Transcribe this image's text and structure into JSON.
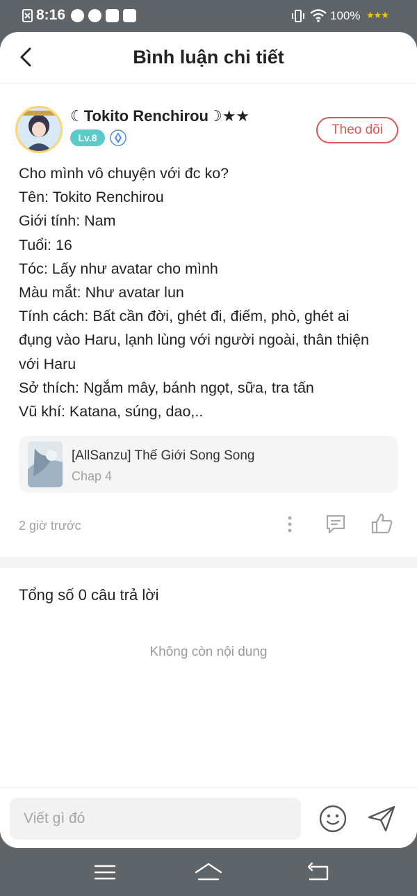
{
  "status_bar": {
    "time": "8:16",
    "battery": "100%",
    "icons": [
      "sim-icon",
      "app-icon",
      "app-icon",
      "mic-icon",
      "video-icon",
      "vibrate-icon",
      "wifi-icon",
      "stars-icon"
    ]
  },
  "header": {
    "title": "Bình luận chi tiết",
    "back_icon": "chevron-left-icon"
  },
  "comment": {
    "author": "☾Tokito Renchirou☽★★",
    "level": "Lv.8",
    "follow_label": "Theo dõi",
    "lines": [
      "Cho mình vô chuyện với đc ko?",
      "Tên: Tokito Renchirou",
      "Giới tính: Nam",
      "Tuổi: 16",
      "Tóc: Lấy như avatar cho mình",
      "Màu mắt: Như avatar lun",
      "Tính cách: Bất cần đời, ghét đi, điếm, phò, ghét ai",
      "đụng vào Haru, lạnh lùng với người ngoài, thân thiện",
      "với Haru",
      "Sở thích: Ngắm mây, bánh ngọt, sữa, tra tấn",
      "Vũ khí: Katana, súng, dao,.."
    ],
    "story": {
      "title": "[AllSanzu] Thế Giới Song Song",
      "chapter": "Chap 4"
    },
    "time_ago": "2 giờ trước"
  },
  "replies": {
    "count_label": "Tổng số 0 câu trả lời",
    "empty_label": "Không còn nội dung"
  },
  "input": {
    "placeholder": "Viết gì đó"
  },
  "colors": {
    "accent": "#e05454",
    "level_badge": "#5ccac8",
    "system_bar": "#5f6468"
  }
}
